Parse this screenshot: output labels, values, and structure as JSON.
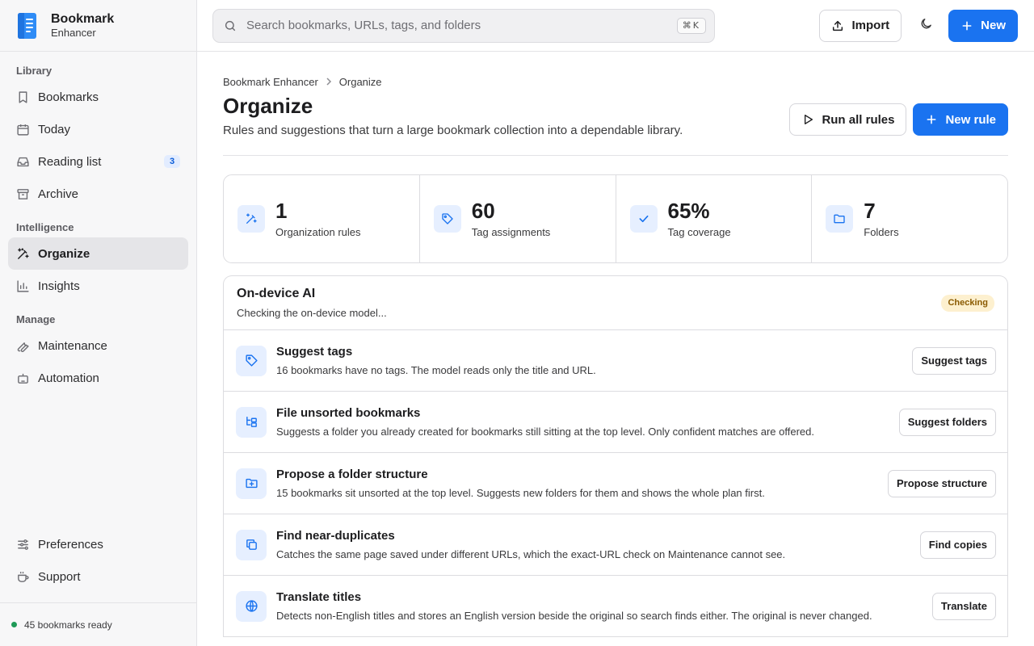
{
  "app": {
    "name": "Bookmark",
    "subtitle": "Enhancer"
  },
  "colors": {
    "accent": "#1a73f0",
    "status_ok": "#1e9a57",
    "badge_warn_bg": "#fdf0cf"
  },
  "sidebar": {
    "sections": {
      "library": "Library",
      "intelligence": "Intelligence",
      "manage": "Manage"
    },
    "items": {
      "bookmarks": "Bookmarks",
      "today": "Today",
      "reading_list": "Reading list",
      "reading_list_count": "3",
      "archive": "Archive",
      "organize": "Organize",
      "insights": "Insights",
      "maintenance": "Maintenance",
      "automation": "Automation",
      "preferences": "Preferences",
      "support": "Support"
    },
    "footer_status": "45 bookmarks ready"
  },
  "topbar": {
    "search_placeholder": "Search bookmarks, URLs, tags, and folders",
    "search_shortcut": "⌘K",
    "import_label": "Import",
    "new_label": "New",
    "theme_icon": "moon-icon"
  },
  "page": {
    "breadcrumb": [
      "Bookmark Enhancer",
      "Organize"
    ],
    "title": "Organize",
    "subtitle": "Rules and suggestions that turn a large bookmark collection into a dependable library.",
    "run_all_label": "Run all rules",
    "new_rule_label": "New rule"
  },
  "stats": [
    {
      "value": "1",
      "label": "Organization rules",
      "icon": "magic-wand-icon"
    },
    {
      "value": "60",
      "label": "Tag assignments",
      "icon": "tag-icon"
    },
    {
      "value": "65%",
      "label": "Tag coverage",
      "icon": "check-icon"
    },
    {
      "value": "7",
      "label": "Folders",
      "icon": "folder-icon"
    }
  ],
  "ai_panel": {
    "title": "On-device AI",
    "status_text": "Checking the on-device model...",
    "badge": "Checking"
  },
  "actions": [
    {
      "title": "Suggest tags",
      "desc": "16 bookmarks have no tags. The model reads only the title and URL.",
      "button": "Suggest tags",
      "icon": "tag-icon"
    },
    {
      "title": "File unsorted bookmarks",
      "desc": "Suggests a folder you already created for bookmarks still sitting at the top level. Only confident matches are offered.",
      "button": "Suggest folders",
      "icon": "folder-tree-icon"
    },
    {
      "title": "Propose a folder structure",
      "desc": "15 bookmarks sit unsorted at the top level. Suggests new folders for them and shows the whole plan first.",
      "button": "Propose structure",
      "icon": "folder-plus-icon"
    },
    {
      "title": "Find near-duplicates",
      "desc": "Catches the same page saved under different URLs, which the exact-URL check on Maintenance cannot see.",
      "button": "Find copies",
      "icon": "copy-icon"
    },
    {
      "title": "Translate titles",
      "desc": "Detects non-English titles and stores an English version beside the original so search finds either. The original is never changed.",
      "button": "Translate",
      "icon": "globe-icon"
    }
  ]
}
